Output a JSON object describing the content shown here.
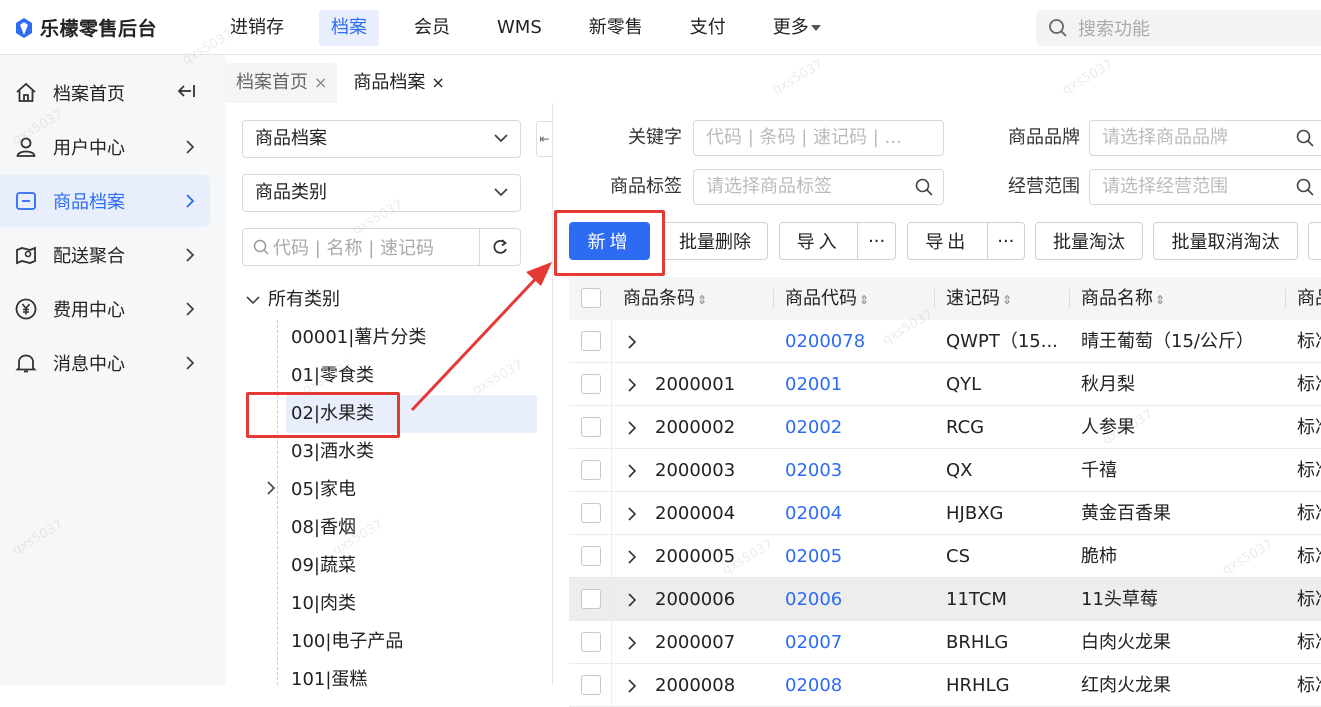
{
  "app": {
    "title": "乐檬零售后台"
  },
  "topnav": {
    "items": [
      "进销存",
      "档案",
      "会员",
      "WMS",
      "新零售",
      "支付",
      "更多"
    ],
    "active": "档案",
    "search_placeholder": "搜索功能"
  },
  "sidebar": {
    "items": [
      {
        "label": "档案首页",
        "icon": "home-icon"
      },
      {
        "label": "用户中心",
        "icon": "user-icon"
      },
      {
        "label": "商品档案",
        "icon": "product-icon"
      },
      {
        "label": "配送聚合",
        "icon": "delivery-icon"
      },
      {
        "label": "费用中心",
        "icon": "yen-icon"
      },
      {
        "label": "消息中心",
        "icon": "bell-icon"
      }
    ],
    "active": "商品档案"
  },
  "tabs": [
    {
      "label": "档案首页",
      "close": "×"
    },
    {
      "label": "商品档案",
      "close": "×"
    }
  ],
  "tree": {
    "select1": "商品档案",
    "select2": "商品类别",
    "search_placeholder": "代码 | 名称 | 速记码",
    "root": "所有类别",
    "nodes": [
      "00001|薯片分类",
      "01|零食类",
      "02|水果类",
      "03|酒水类",
      "05|家电",
      "08|香烟",
      "09|蔬菜",
      "10|肉类",
      "100|电子产品",
      "101|蛋糕"
    ],
    "selected": "02|水果类"
  },
  "filters": {
    "keyword_label": "关键字",
    "keyword_placeholder": "代码 | 条码 | 速记码 | ...",
    "brand_label": "商品品牌",
    "brand_placeholder": "请选择商品品牌",
    "tag_label": "商品标签",
    "tag_placeholder": "请选择商品标签",
    "scope_label": "经营范围",
    "scope_placeholder": "请选择经营范围"
  },
  "toolbar": {
    "add": "新增",
    "batch_delete": "批量删除",
    "import": "导入",
    "export": "导出",
    "more": "···",
    "batch_eliminate": "批量淘汰",
    "batch_cancel_eliminate": "批量取消淘汰"
  },
  "table": {
    "columns": [
      "商品条码",
      "商品代码",
      "速记码",
      "商品名称",
      "商品"
    ],
    "rows": [
      {
        "barcode": "",
        "code": "0200078",
        "shorthand": "QWPT（15...",
        "name": "晴王葡萄（15/公斤）",
        "extra": "标准"
      },
      {
        "barcode": "2000001",
        "code": "02001",
        "shorthand": "QYL",
        "name": "秋月梨",
        "extra": "标准"
      },
      {
        "barcode": "2000002",
        "code": "02002",
        "shorthand": "RCG",
        "name": "人参果",
        "extra": "标准"
      },
      {
        "barcode": "2000003",
        "code": "02003",
        "shorthand": "QX",
        "name": "千禧",
        "extra": "标准"
      },
      {
        "barcode": "2000004",
        "code": "02004",
        "shorthand": "HJBXG",
        "name": "黄金百香果",
        "extra": "标准"
      },
      {
        "barcode": "2000005",
        "code": "02005",
        "shorthand": "CS",
        "name": "脆柿",
        "extra": "标准"
      },
      {
        "barcode": "2000006",
        "code": "02006",
        "shorthand": "11TCM",
        "name": "11头草莓",
        "extra": "标准"
      },
      {
        "barcode": "2000007",
        "code": "02007",
        "shorthand": "BRHLG",
        "name": "白肉火龙果",
        "extra": "标准"
      },
      {
        "barcode": "2000008",
        "code": "02008",
        "shorthand": "HRHLG",
        "name": "红肉火龙果",
        "extra": "标准"
      }
    ]
  },
  "watermark": "qxs5037",
  "colors": {
    "accent": "#2d6bf2",
    "annotation": "#e53935"
  }
}
